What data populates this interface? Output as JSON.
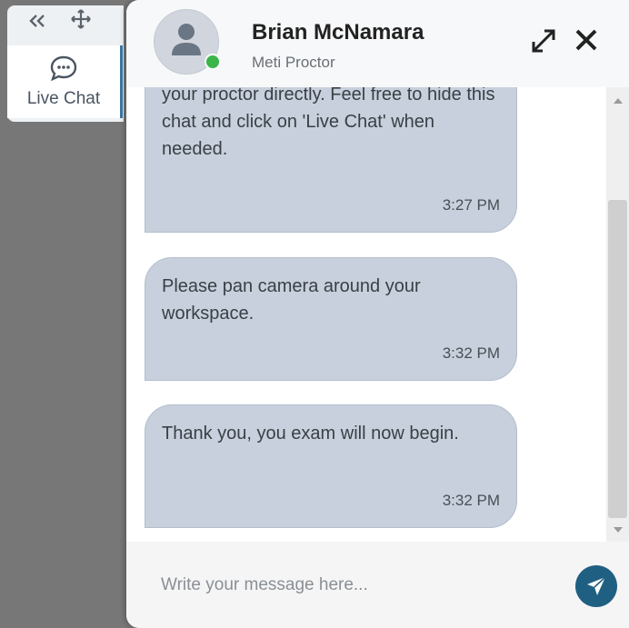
{
  "sidebar": {
    "live_chat_label": "Live Chat",
    "icons": [
      "collapse-double-chevron-icon",
      "move-arrows-icon",
      "chat-bubble-icon"
    ]
  },
  "header": {
    "name": "Brian McNamara",
    "role": "Meti Proctor",
    "status": "online",
    "icons": [
      "expand-icon",
      "close-icon"
    ]
  },
  "messages": [
    {
      "text": "proctor. Here you can communicate with your proctor directly. Feel free to hide this chat and click on 'Live Chat' when needed.",
      "time": "3:27 PM"
    },
    {
      "text": "Please pan camera around your workspace.",
      "time": "3:32 PM"
    },
    {
      "text": "Thank you, you exam will now begin.",
      "time": "3:32 PM"
    }
  ],
  "composer": {
    "placeholder": "Write your message here...",
    "send_icon": "send-icon"
  },
  "colors": {
    "accent": "#1f5f82",
    "bubble": "#c7d0dc",
    "online": "#3bb54a",
    "backdrop": "#777777"
  }
}
